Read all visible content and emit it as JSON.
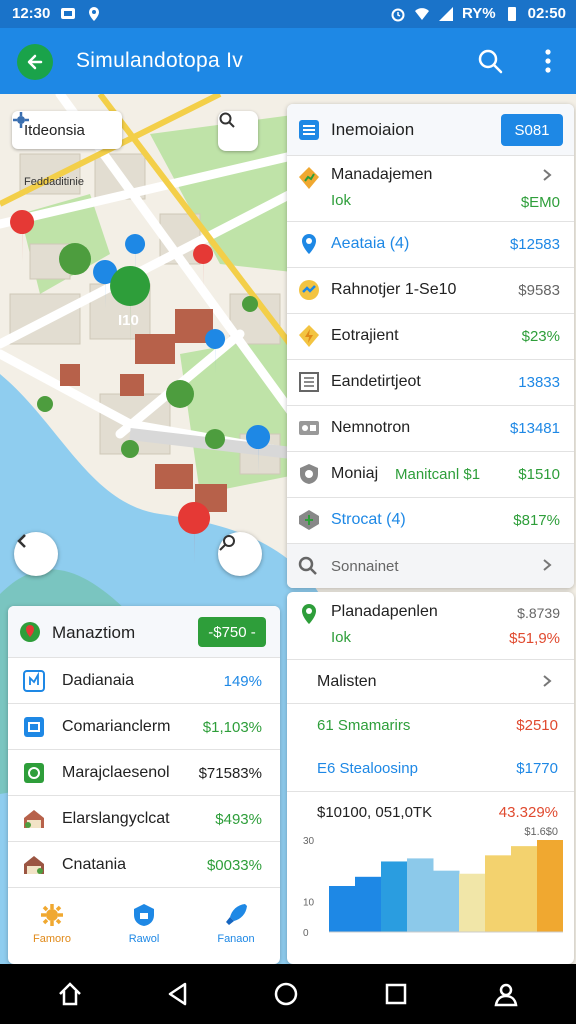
{
  "status_bar": {
    "time_left": "12:30",
    "battery_text": "%",
    "signal_pct": "RY%",
    "time_right": "02:50"
  },
  "app_bar": {
    "title": "Simulandotopa Iv"
  },
  "map": {
    "search_chip_label": "Itdeonsia",
    "street_label": "Feddaditinie",
    "pin_label": "I10"
  },
  "right_panel": {
    "header_title": "Inemoiaion",
    "header_badge": "S081",
    "items": [
      {
        "label": "Manadajemen",
        "sub": "Iok",
        "value": "$EM0"
      },
      {
        "label": "Aeataia (4)",
        "value": "$12583"
      },
      {
        "label": "Rahnotjer 1-Se10",
        "value": "$9583"
      },
      {
        "label": "Eotrajient",
        "value": "$23%"
      },
      {
        "label": "Eandetirtjeot",
        "value": "13833"
      },
      {
        "label": "Nemnotron",
        "value": "$13481"
      },
      {
        "label": "Moniaj",
        "mid": "Manitcanl $1",
        "value": "$1510"
      },
      {
        "label": "Strocat (4)",
        "value": "$817%"
      }
    ],
    "footer_label": "Sonnainet"
  },
  "right_panel2": {
    "title": "Planadapenlen",
    "sub": "Iok",
    "value_top": "$.8739",
    "value_bottom": "$51,9%",
    "rows": [
      {
        "label": "Malisten"
      },
      {
        "label": "61 Smamarirs",
        "value": "$2510"
      },
      {
        "label": "E6 Stealoosinp",
        "value": "$1770"
      }
    ],
    "chart_header": "$10100, 051,0TK",
    "chart_value": "43.329%",
    "chart_sub": "$1.6$0"
  },
  "chart_data": {
    "type": "area",
    "title": "",
    "xlabel": "",
    "ylabel": "",
    "ylim": [
      0,
      30
    ],
    "y_ticks": [
      "30",
      "10",
      "0"
    ],
    "series": [
      {
        "values": [
          15,
          18,
          23,
          24,
          20,
          19,
          25,
          28,
          30
        ]
      }
    ],
    "colors": [
      "#1e88e5",
      "#2a9de0",
      "#8cc9ea",
      "#f1e6a8",
      "#f3d26e",
      "#f0a830"
    ]
  },
  "left_panel": {
    "header_title": "Manaztiom",
    "header_badge": "-$750 -",
    "items": [
      {
        "label": "Dadianaia",
        "value": "149%"
      },
      {
        "label": "Comarianclerm",
        "value": "$1,103%"
      },
      {
        "label": "Marajclaesenol",
        "value": "$71583%"
      },
      {
        "label": "Elarslangyclcat",
        "value": "$493%"
      },
      {
        "label": "Cnatania",
        "value": "$0033%"
      }
    ],
    "tabs": [
      "Famoro",
      "Rawol",
      "Fanaon"
    ]
  },
  "colors": {
    "primary": "#1e88e5",
    "accent_green": "#2e9e3a",
    "accent_red": "#e04a2f"
  }
}
